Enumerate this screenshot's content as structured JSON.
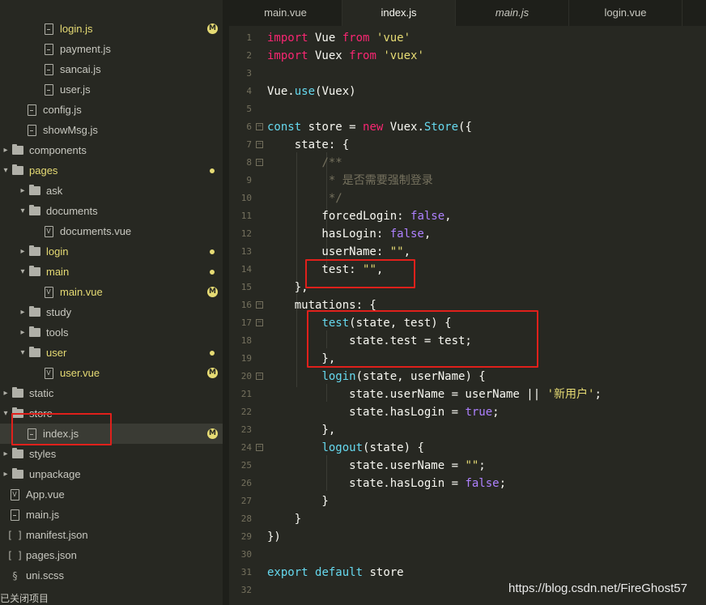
{
  "sidebar": {
    "items": [
      {
        "label": "login.js",
        "type": "file",
        "modified": true,
        "badge": "M"
      },
      {
        "label": "payment.js",
        "type": "file"
      },
      {
        "label": "sancai.js",
        "type": "file"
      },
      {
        "label": "user.js",
        "type": "file"
      },
      {
        "label": "config.js",
        "type": "file"
      },
      {
        "label": "showMsg.js",
        "type": "file"
      },
      {
        "label": "components",
        "type": "folder",
        "expanded": false
      },
      {
        "label": "pages",
        "type": "folder",
        "expanded": true,
        "modified": true
      },
      {
        "label": "ask",
        "type": "folder",
        "expanded": false
      },
      {
        "label": "documents",
        "type": "folder",
        "expanded": true
      },
      {
        "label": "documents.vue",
        "type": "vue"
      },
      {
        "label": "login",
        "type": "folder",
        "expanded": false,
        "modified": true
      },
      {
        "label": "main",
        "type": "folder",
        "expanded": true,
        "modified": true
      },
      {
        "label": "main.vue",
        "type": "vue",
        "modified": true,
        "badge": "M"
      },
      {
        "label": "study",
        "type": "folder",
        "expanded": false
      },
      {
        "label": "tools",
        "type": "folder",
        "expanded": false
      },
      {
        "label": "user",
        "type": "folder",
        "expanded": true,
        "modified": true
      },
      {
        "label": "user.vue",
        "type": "vue",
        "modified": true,
        "badge": "M"
      },
      {
        "label": "static",
        "type": "folder",
        "expanded": false
      },
      {
        "label": "store",
        "type": "folder",
        "expanded": true
      },
      {
        "label": "index.js",
        "type": "file",
        "selected": true,
        "badge": "M"
      },
      {
        "label": "styles",
        "type": "folder",
        "expanded": false
      },
      {
        "label": "unpackage",
        "type": "folder",
        "expanded": false
      },
      {
        "label": "App.vue",
        "type": "vue"
      },
      {
        "label": "main.js",
        "type": "file"
      },
      {
        "label": "manifest.json",
        "type": "json"
      },
      {
        "label": "pages.json",
        "type": "json"
      },
      {
        "label": "uni.scss",
        "type": "scss"
      }
    ],
    "close_project": "已关闭项目"
  },
  "tabs": [
    {
      "label": "main.vue",
      "active": false,
      "italic": false
    },
    {
      "label": "index.js",
      "active": true,
      "italic": false
    },
    {
      "label": "main.js",
      "active": false,
      "italic": true
    },
    {
      "label": "login.vue",
      "active": false,
      "italic": false
    }
  ],
  "editor": {
    "line_numbers": [
      "1",
      "2",
      "3",
      "4",
      "5",
      "6",
      "7",
      "8",
      "9",
      "10",
      "11",
      "12",
      "13",
      "14",
      "15",
      "16",
      "17",
      "18",
      "19",
      "20",
      "21",
      "22",
      "23",
      "24",
      "25",
      "26",
      "27",
      "28",
      "29",
      "30",
      "31",
      "32"
    ],
    "comment_text": " * 是否需要强制登录",
    "new_user_string": "'新用户'"
  },
  "watermark": "https://blog.csdn.net/FireGhost57",
  "colors": {
    "background": "#272822",
    "keyword": "#66d9ef",
    "string": "#e6db74",
    "boolean": "#ae81ff",
    "import": "#f92672",
    "highlight_box": "#e0201b"
  }
}
